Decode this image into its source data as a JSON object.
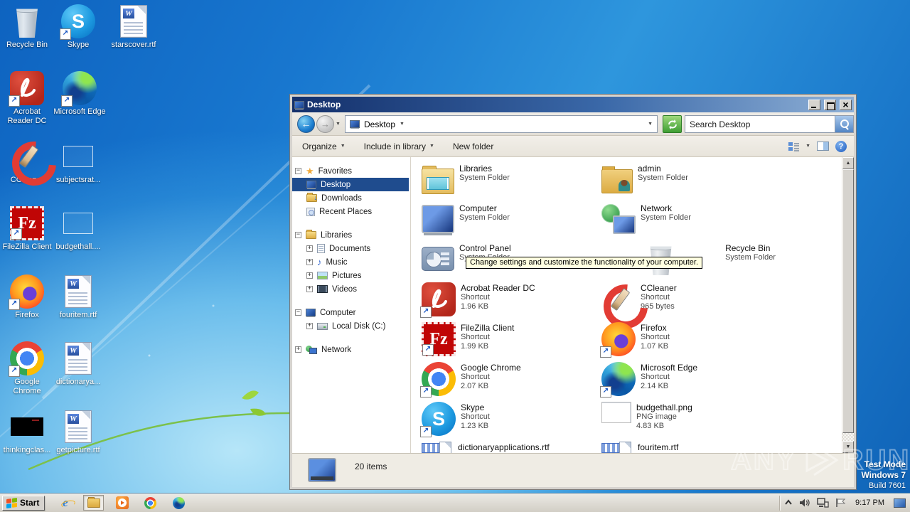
{
  "desktop": {
    "icons": [
      {
        "label": "Recycle Bin"
      },
      {
        "label": "Skype"
      },
      {
        "label": "starscover.rtf"
      },
      {
        "label": "Acrobat Reader DC"
      },
      {
        "label": "Microsoft Edge"
      },
      {
        "label": "CCleaner"
      },
      {
        "label": "subjectsrat..."
      },
      {
        "label": "FileZilla Client"
      },
      {
        "label": "budgethall...."
      },
      {
        "label": "Firefox"
      },
      {
        "label": "fouritem.rtf"
      },
      {
        "label": "Google Chrome"
      },
      {
        "label": "dictionarya..."
      },
      {
        "label": "thinkingclas..."
      },
      {
        "label": "getpicture.rtf"
      }
    ]
  },
  "window": {
    "title": "Desktop",
    "address": {
      "location": "Desktop"
    },
    "search": {
      "placeholder": "Search Desktop"
    },
    "toolbar": {
      "organize": "Organize",
      "include_in_library": "Include in library",
      "new_folder": "New folder"
    },
    "nav": {
      "favorites": {
        "label": "Favorites",
        "items": [
          {
            "label": "Desktop"
          },
          {
            "label": "Downloads"
          },
          {
            "label": "Recent Places"
          }
        ]
      },
      "libraries": {
        "label": "Libraries",
        "items": [
          {
            "label": "Documents"
          },
          {
            "label": "Music"
          },
          {
            "label": "Pictures"
          },
          {
            "label": "Videos"
          }
        ]
      },
      "computer": {
        "label": "Computer",
        "items": [
          {
            "label": "Local Disk (C:)"
          }
        ]
      },
      "network": {
        "label": "Network"
      }
    },
    "files": [
      {
        "name": "Libraries",
        "line1": "System Folder",
        "line2": ""
      },
      {
        "name": "admin",
        "line1": "System Folder",
        "line2": ""
      },
      {
        "name": "Computer",
        "line1": "System Folder",
        "line2": ""
      },
      {
        "name": "Network",
        "line1": "System Folder",
        "line2": ""
      },
      {
        "name": "Control Panel",
        "line1": "System Folder",
        "line2": ""
      },
      {
        "name": "Recycle Bin",
        "line1": "System Folder",
        "line2": ""
      },
      {
        "name": "Acrobat Reader DC",
        "line1": "Shortcut",
        "line2": "1.96 KB"
      },
      {
        "name": "CCleaner",
        "line1": "Shortcut",
        "line2": "965 bytes"
      },
      {
        "name": "FileZilla Client",
        "line1": "Shortcut",
        "line2": "1.99 KB"
      },
      {
        "name": "Firefox",
        "line1": "Shortcut",
        "line2": "1.07 KB"
      },
      {
        "name": "Google Chrome",
        "line1": "Shortcut",
        "line2": "2.07 KB"
      },
      {
        "name": "Microsoft Edge",
        "line1": "Shortcut",
        "line2": "2.14 KB"
      },
      {
        "name": "Skype",
        "line1": "Shortcut",
        "line2": "1.23 KB"
      },
      {
        "name": "budgethall.png",
        "line1": "PNG image",
        "line2": "4.83 KB"
      },
      {
        "name": "dictionaryapplications.rtf",
        "line1": "",
        "line2": ""
      },
      {
        "name": "fouritem.rtf",
        "line1": "",
        "line2": ""
      }
    ],
    "tooltip": "Change settings and customize the functionality of your computer.",
    "status": {
      "count": "20 items"
    }
  },
  "taskbar": {
    "start_label": "Start",
    "clock": "9:17 PM"
  },
  "overlay": {
    "brand_left": "ANY",
    "brand_right": "RUN",
    "test_mode": "Test Mode",
    "os_name": "Windows 7",
    "build": "Build 7601"
  }
}
